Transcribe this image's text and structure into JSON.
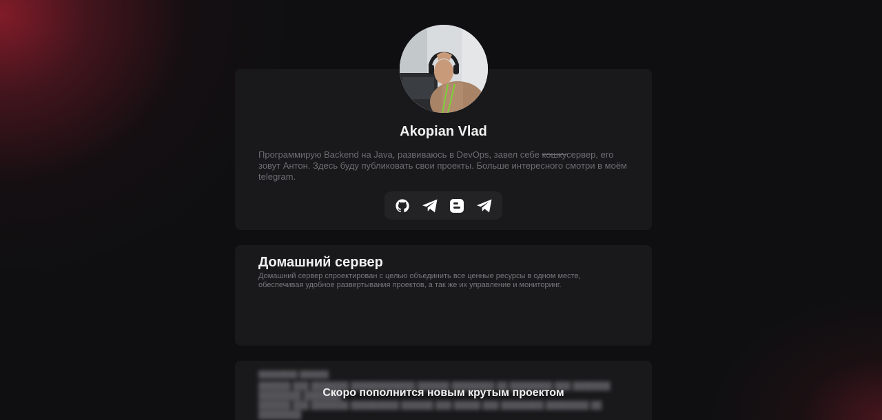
{
  "profile": {
    "name": "Akopian Vlad",
    "bio_part1": "Программирую Backend на Java, развиваюсь в DevOps, завел себе ",
    "bio_strike": "кошку",
    "bio_part2": "сервер, его зовут Антон. Здесь буду публиковать свои проекты. Больше интересного смотри в моём telegram.",
    "socials": [
      {
        "icon": "github-icon"
      },
      {
        "icon": "telegram-icon"
      },
      {
        "icon": "blogger-icon"
      },
      {
        "icon": "telegram-icon"
      }
    ]
  },
  "project": {
    "title": "Домашний сервер",
    "description": "Домашний сервер спроектирован с целью объединить все ценные ресурсы в одном месте, обеспечивая удобное развертывания проектов, а так же их управление и мониторинг."
  },
  "upcoming": {
    "message": "Скоро пополнится новым крутым проектом"
  },
  "colors": {
    "background": "#0f0f11",
    "card": "#19191b",
    "accent_red": "#961e2d",
    "text_primary": "#f2f2f2",
    "text_muted": "#6d6d72"
  }
}
